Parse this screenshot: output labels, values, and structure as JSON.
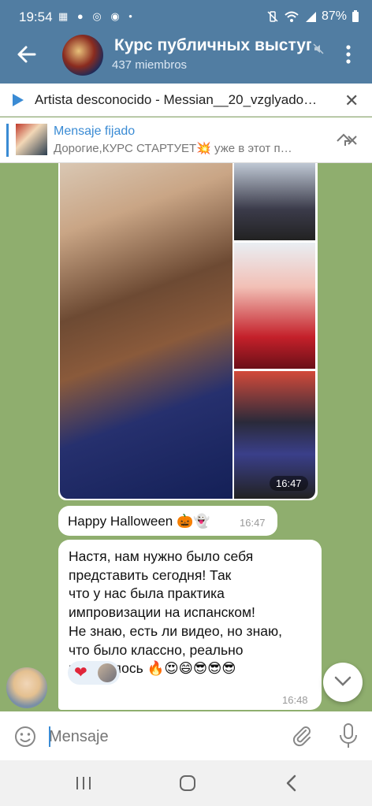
{
  "status_bar": {
    "time": "19:54",
    "left_icons": "▦ ● ◎ ◉ •",
    "battery": "87%"
  },
  "header": {
    "title": "Курс публичных выступ",
    "subtitle": "437 miembros"
  },
  "audio_player": {
    "track": "Artista desconocido - Messian__20_vzglyado…"
  },
  "pinned": {
    "label": "Mensaje fijado",
    "text": "Дорогие,КУРС СТАРТУЕТ💥 уже в этот п…"
  },
  "messages": [
    {
      "type": "album",
      "time": "16:47"
    },
    {
      "type": "text",
      "text": "Happy Halloween 🎃👻",
      "time": "16:47"
    },
    {
      "type": "text",
      "text": "Настя, нам нужно было себя\nпредставить сегодня! Так\nчто у нас была практика\nимпровизации на испанском!\nНе знаю, есть ли видео, но знаю,\nчто было классно, реально\nполучилось 🔥😍😄😎😎😎",
      "time": "16:48",
      "reaction": "❤"
    }
  ],
  "input": {
    "placeholder": "Mensaje"
  },
  "colors": {
    "header": "#517da2",
    "accent": "#3a8bd4",
    "chat_background": "#8fae6e"
  }
}
